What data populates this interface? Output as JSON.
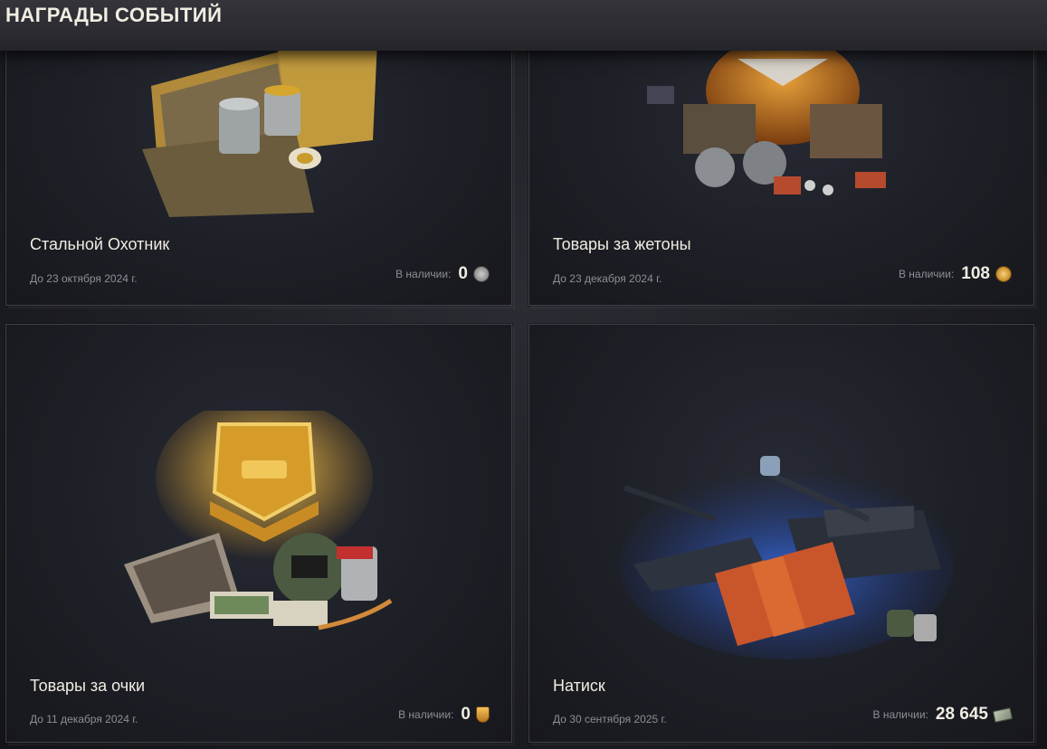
{
  "header": {
    "title": "НАГРАДЫ СОБЫТИЙ"
  },
  "cards": [
    {
      "title": "Стальной Охотник",
      "date": "До 23 октября 2024 г.",
      "available_label": "В наличии:",
      "available_value": "0",
      "currency_icon": "steel-hunter-token-icon"
    },
    {
      "title": "Товары за жетоны",
      "date": "До 23 декабря 2024 г.",
      "available_label": "В наличии:",
      "available_value": "108",
      "currency_icon": "gold-token-icon"
    },
    {
      "title": "Товары за очки",
      "date": "До 11 декабря 2024 г.",
      "available_label": "В наличии:",
      "available_value": "0",
      "currency_icon": "points-shield-icon"
    },
    {
      "title": "Натиск",
      "date": "До 30 сентября 2025 г.",
      "available_label": "В наличии:",
      "available_value": "28 645",
      "currency_icon": "onslaught-bills-icon"
    }
  ],
  "colors": {
    "background": "#1c1d22",
    "card_border": "#3e4048",
    "title_text": "#f0ece2",
    "muted_text": "#8d8f96",
    "gold": "#d9a441"
  }
}
